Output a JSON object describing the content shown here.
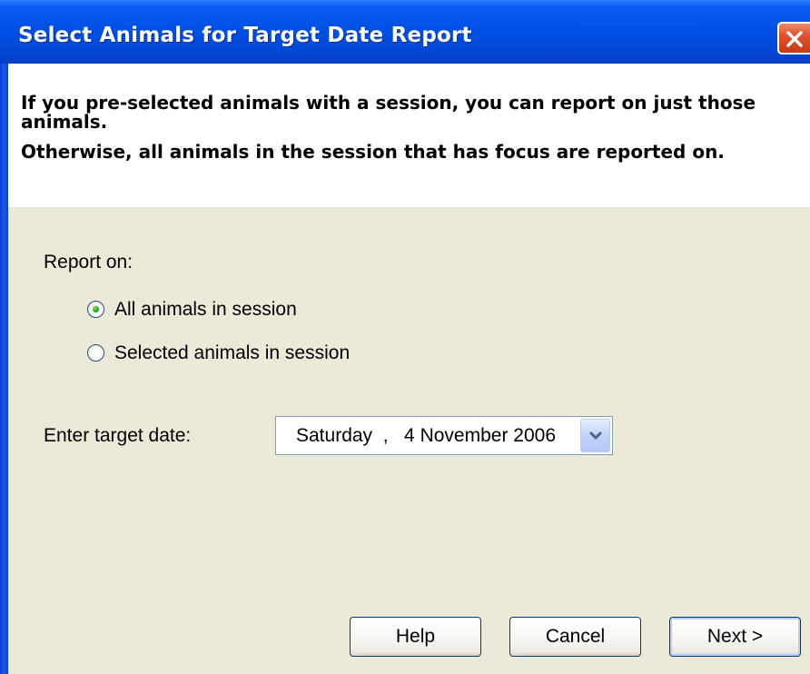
{
  "window": {
    "title": "Select Animals for Target Date Report"
  },
  "header": {
    "line1": "If you pre-selected animals with a session, you can report on just those",
    "line2": "animals.",
    "line3": "Otherwise, all animals in the session that has focus are reported on."
  },
  "report_on": {
    "label": "Report on:",
    "options": [
      {
        "label": "All animals in session",
        "checked": true
      },
      {
        "label": "Selected animals in session",
        "checked": false
      }
    ]
  },
  "target_date": {
    "label": "Enter target date:",
    "value": "Saturday  ,   4 November 2006"
  },
  "buttons": {
    "help": "Help",
    "cancel": "Cancel",
    "next": "Next >"
  },
  "colors": {
    "title_bar": "#0050E6",
    "dialog_bg": "#ECE9D8",
    "header_bg": "#FFFFFF",
    "close_button": "#E0532E",
    "radio_selected_dot": "#21A121"
  },
  "icons": {
    "close": "close-icon",
    "dropdown": "chevron-down-icon"
  }
}
